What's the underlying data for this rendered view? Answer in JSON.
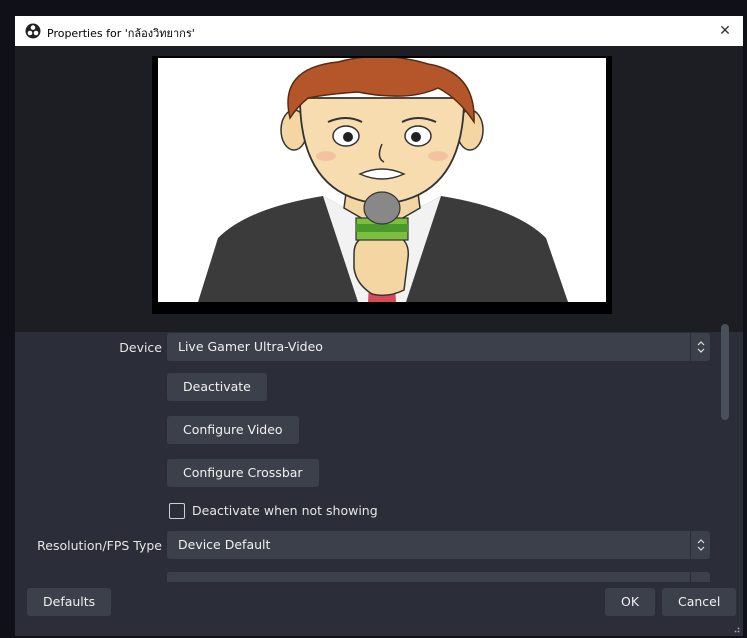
{
  "window": {
    "title": "Properties for 'กล้องวิทยากร'",
    "close_glyph": "✕"
  },
  "preview": {
    "image": "cartoon-reporter-with-microphone"
  },
  "properties": {
    "device_label": "Device",
    "device_value": "Live Gamer Ultra-Video",
    "deactivate_button": "Deactivate",
    "configure_video_button": "Configure Video",
    "configure_crossbar_button": "Configure Crossbar",
    "deactivate_when_not_showing_label": "Deactivate when not showing",
    "deactivate_when_not_showing_checked": false,
    "resolution_label": "Resolution/FPS Type",
    "resolution_value": "Device Default"
  },
  "footer": {
    "defaults_button": "Defaults",
    "ok_button": "OK",
    "cancel_button": "Cancel"
  },
  "colors": {
    "dialog_bg": "#2b2e38",
    "preview_bg": "#1c1e24",
    "control_bg": "#3c404b",
    "text": "#e6e6e6"
  }
}
